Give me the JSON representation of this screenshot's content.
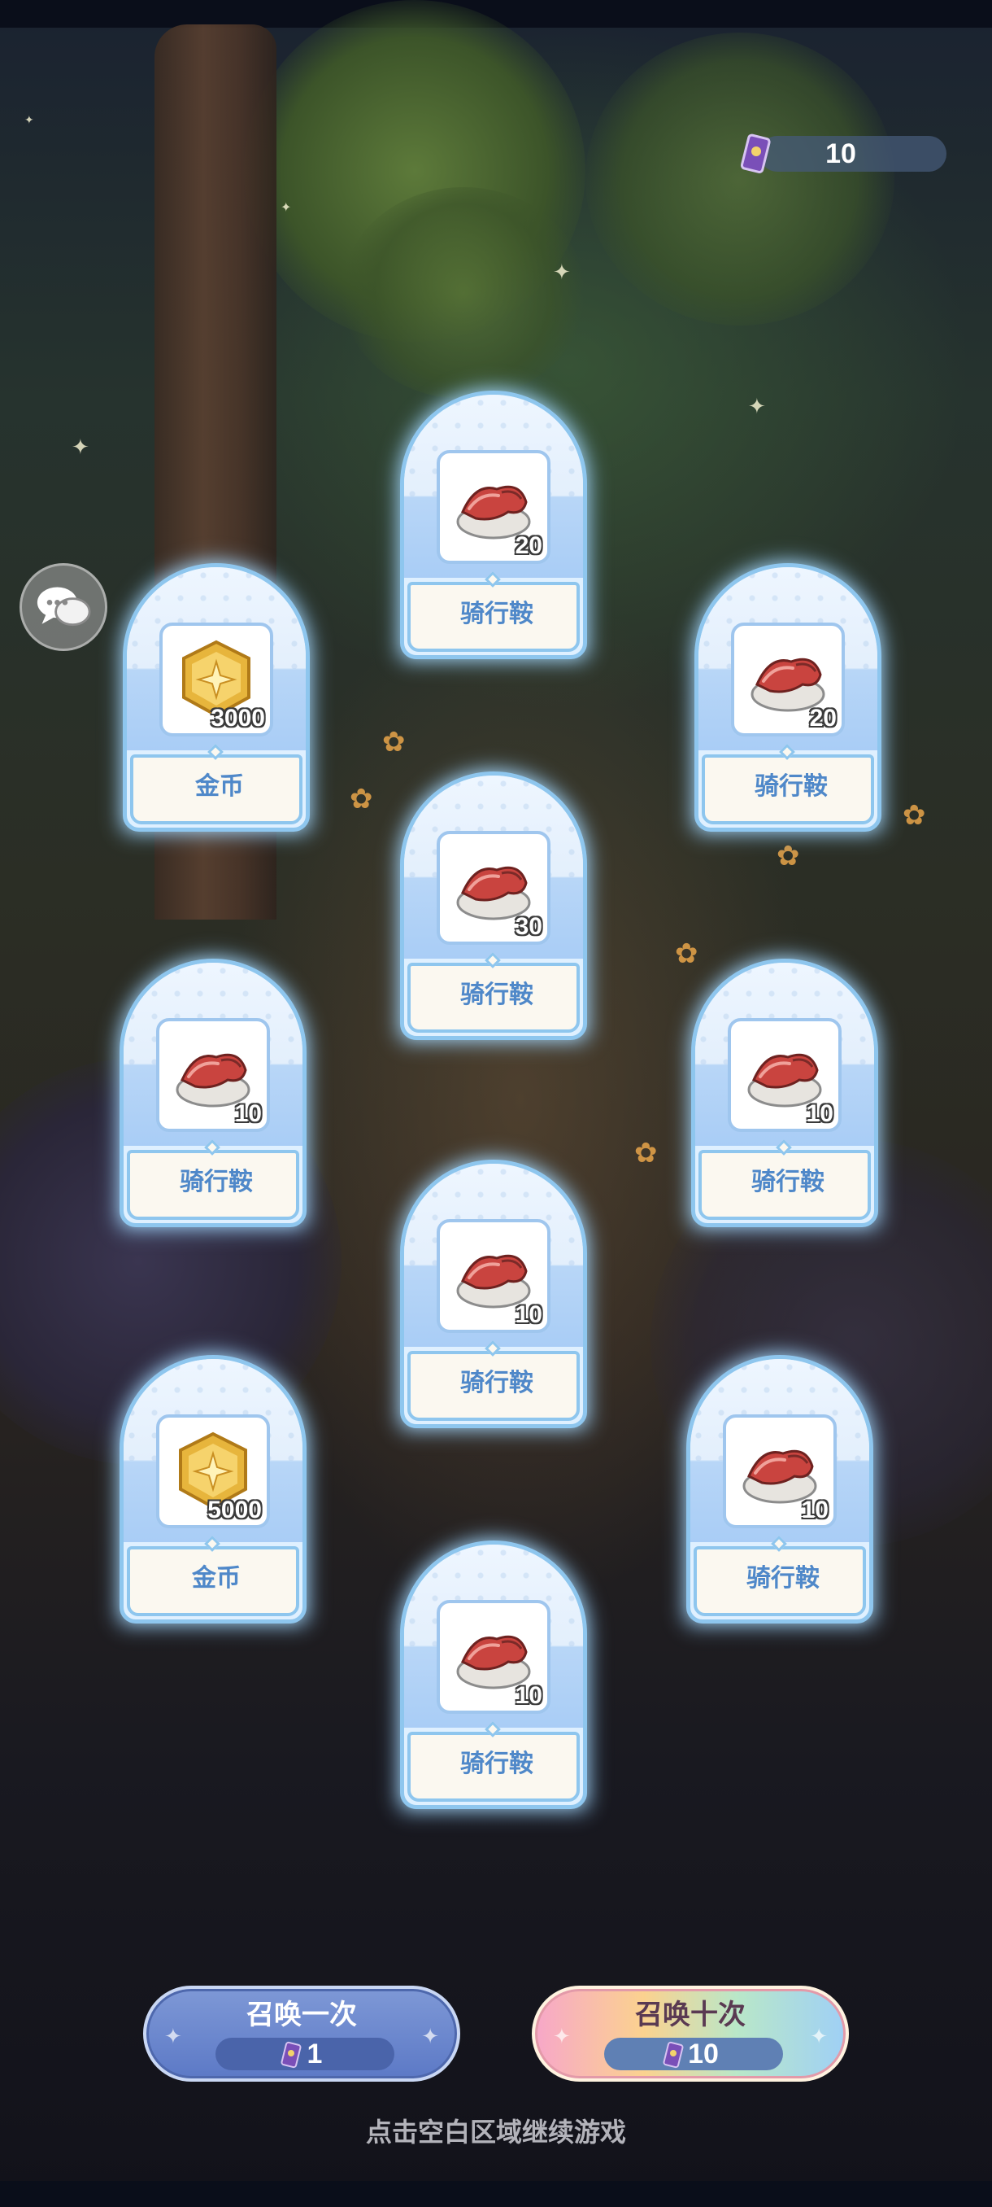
{
  "currency": {
    "icon": "summon-ticket-icon",
    "value": "10"
  },
  "chat": {
    "icon": "chat-bubbles-icon"
  },
  "rewards": [
    {
      "name": "骑行鞍",
      "qty": "20",
      "icon": "saddle-icon"
    },
    {
      "name": "金币",
      "qty": "3000",
      "icon": "gold-coin-icon"
    },
    {
      "name": "骑行鞍",
      "qty": "20",
      "icon": "saddle-icon"
    },
    {
      "name": "骑行鞍",
      "qty": "30",
      "icon": "saddle-icon"
    },
    {
      "name": "骑行鞍",
      "qty": "10",
      "icon": "saddle-icon"
    },
    {
      "name": "骑行鞍",
      "qty": "10",
      "icon": "saddle-icon"
    },
    {
      "name": "骑行鞍",
      "qty": "10",
      "icon": "saddle-icon"
    },
    {
      "name": "金币",
      "qty": "5000",
      "icon": "gold-coin-icon"
    },
    {
      "name": "骑行鞍",
      "qty": "10",
      "icon": "saddle-icon"
    },
    {
      "name": "骑行鞍",
      "qty": "10",
      "icon": "saddle-icon"
    }
  ],
  "buttons": {
    "summon_once": {
      "label": "召唤一次",
      "cost": "1"
    },
    "summon_ten": {
      "label": "召唤十次",
      "cost": "10"
    }
  },
  "hint": "点击空白区域继续游戏",
  "colors": {
    "card_border": "#8ec6ee",
    "card_name": "#4f88c9",
    "button_one": "#5c79c6"
  }
}
